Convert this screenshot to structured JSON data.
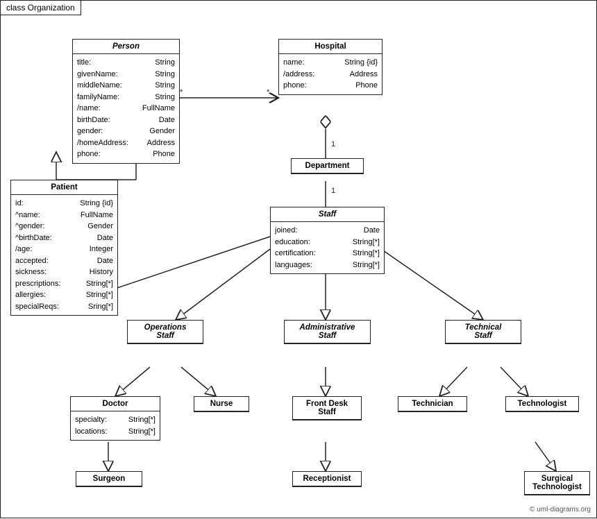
{
  "diagram": {
    "title": "class Organization",
    "copyright": "© uml-diagrams.org",
    "classes": {
      "person": {
        "name": "Person",
        "italic": true,
        "attrs": [
          {
            "name": "title:",
            "type": "String"
          },
          {
            "name": "givenName:",
            "type": "String"
          },
          {
            "name": "middleName:",
            "type": "String"
          },
          {
            "name": "familyName:",
            "type": "String"
          },
          {
            "name": "/name:",
            "type": "FullName"
          },
          {
            "name": "birthDate:",
            "type": "Date"
          },
          {
            "name": "gender:",
            "type": "Gender"
          },
          {
            "name": "/homeAddress:",
            "type": "Address"
          },
          {
            "name": "phone:",
            "type": "Phone"
          }
        ]
      },
      "hospital": {
        "name": "Hospital",
        "italic": false,
        "attrs": [
          {
            "name": "name:",
            "type": "String {id}"
          },
          {
            "name": "/address:",
            "type": "Address"
          },
          {
            "name": "phone:",
            "type": "Phone"
          }
        ]
      },
      "department": {
        "name": "Department",
        "italic": false,
        "attrs": []
      },
      "staff": {
        "name": "Staff",
        "italic": true,
        "attrs": [
          {
            "name": "joined:",
            "type": "Date"
          },
          {
            "name": "education:",
            "type": "String[*]"
          },
          {
            "name": "certification:",
            "type": "String[*]"
          },
          {
            "name": "languages:",
            "type": "String[*]"
          }
        ]
      },
      "patient": {
        "name": "Patient",
        "italic": false,
        "attrs": [
          {
            "name": "id:",
            "type": "String {id}"
          },
          {
            "name": "^name:",
            "type": "FullName"
          },
          {
            "name": "^gender:",
            "type": "Gender"
          },
          {
            "name": "^birthDate:",
            "type": "Date"
          },
          {
            "name": "/age:",
            "type": "Integer"
          },
          {
            "name": "accepted:",
            "type": "Date"
          },
          {
            "name": "sickness:",
            "type": "History"
          },
          {
            "name": "prescriptions:",
            "type": "String[*]"
          },
          {
            "name": "allergies:",
            "type": "String[*]"
          },
          {
            "name": "specialReqs:",
            "type": "Sring[*]"
          }
        ]
      },
      "operations_staff": {
        "name": "Operations\nStaff",
        "italic": true,
        "attrs": []
      },
      "administrative_staff": {
        "name": "Administrative\nStaff",
        "italic": true,
        "attrs": []
      },
      "technical_staff": {
        "name": "Technical\nStaff",
        "italic": true,
        "attrs": []
      },
      "doctor": {
        "name": "Doctor",
        "italic": false,
        "attrs": [
          {
            "name": "specialty:",
            "type": "String[*]"
          },
          {
            "name": "locations:",
            "type": "String[*]"
          }
        ]
      },
      "nurse": {
        "name": "Nurse",
        "italic": false,
        "attrs": []
      },
      "front_desk_staff": {
        "name": "Front Desk\nStaff",
        "italic": false,
        "attrs": []
      },
      "technician": {
        "name": "Technician",
        "italic": false,
        "attrs": []
      },
      "technologist": {
        "name": "Technologist",
        "italic": false,
        "attrs": []
      },
      "surgeon": {
        "name": "Surgeon",
        "italic": false,
        "attrs": []
      },
      "receptionist": {
        "name": "Receptionist",
        "italic": false,
        "attrs": []
      },
      "surgical_technologist": {
        "name": "Surgical\nTechnologist",
        "italic": false,
        "attrs": []
      }
    }
  }
}
